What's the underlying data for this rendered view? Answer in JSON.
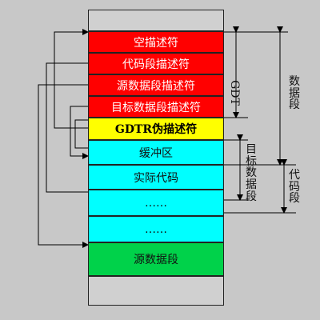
{
  "memory_blocks": [
    {
      "label": "",
      "kind": "gray"
    },
    {
      "label": "空描述符",
      "kind": "red"
    },
    {
      "label": "代码段描述符",
      "kind": "red"
    },
    {
      "label": "源数据段描述符",
      "kind": "red"
    },
    {
      "label": "目标数据段描述符",
      "kind": "red"
    },
    {
      "label": "GDTR伪描述符",
      "kind": "yellow"
    },
    {
      "label": "缓冲区",
      "kind": "cyan"
    },
    {
      "label": "实际代码",
      "kind": "cyan"
    },
    {
      "label": "……",
      "kind": "cyan"
    },
    {
      "label": "……",
      "kind": "cyan"
    },
    {
      "label": "源数据段",
      "kind": "green"
    },
    {
      "label": "",
      "kind": "gray"
    }
  ],
  "brackets": {
    "gdt": "GDT",
    "data_segment": "数据段",
    "target_data_segment": "目标数据段",
    "code_segment": "代码段"
  },
  "colors": {
    "red": "#ff0000",
    "yellow": "#ffff00",
    "cyan": "#00ffff",
    "green": "#00d24a",
    "background": "#c8c8c8"
  }
}
